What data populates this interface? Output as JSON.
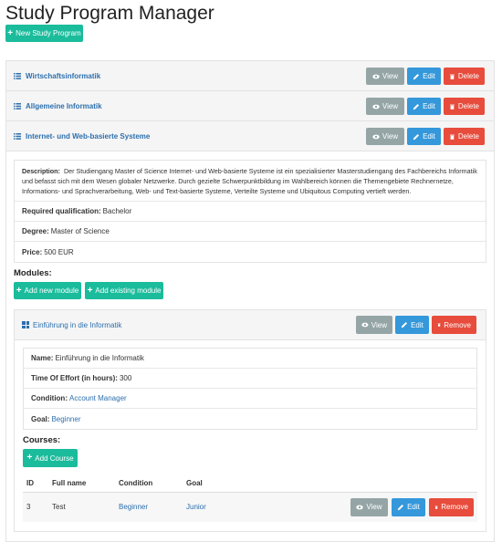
{
  "page": {
    "title": "Study Program Manager",
    "new_program_label": "New Study Program"
  },
  "actions": {
    "view": "View",
    "edit": "Edit",
    "delete": "Delete",
    "remove": "Remove"
  },
  "programs": [
    {
      "name": "Wirtschaftsinformatik"
    },
    {
      "name": "Allgemeine Informatik"
    },
    {
      "name": "Internet- und Web-basierte Systeme"
    }
  ],
  "expanded_program": {
    "description_label": "Description:",
    "description": "Der Studiengang Master of Science Internet- und Web-basierte Systeme ist ein spezialisierter Masterstudiengang des Fachbereichs Informatik und befasst sich mit dem Wesen globaler Netzwerke. Durch gezielte Schwerpunktbildung im Wahlbereich können die Themengebiete Rechnernetze, Informations- und Sprachverarbeitung, Web- und Text-basierte Systeme, Verteilte Systeme und Ubiquitous Computing vertieft werden.",
    "qualification_label": "Required qualification:",
    "qualification": "Bachelor",
    "degree_label": "Degree:",
    "degree": "Master of Science",
    "price_label": "Price:",
    "price": "500 EUR",
    "modules_heading": "Modules:",
    "add_new_module": "Add new module",
    "add_existing_module": "Add existing module"
  },
  "module": {
    "title": "Einführung in die Informatik",
    "name_label": "Name:",
    "name": "Einführung in die Informatik",
    "effort_label": "Time Of Effort (in hours):",
    "effort": "300",
    "condition_label": "Condition:",
    "condition": "Account Manager",
    "goal_label": "Goal:",
    "goal": "Beginner",
    "courses_heading": "Courses:",
    "add_course": "Add Course"
  },
  "courses": {
    "headers": [
      "ID",
      "Full name",
      "Condition",
      "Goal"
    ],
    "rows": [
      {
        "id": "3",
        "full_name": "Test",
        "condition": "Beginner",
        "goal": "Junior"
      }
    ]
  },
  "colors": {
    "teal": "#1abc9c",
    "gray": "#95a5a6",
    "blue": "#3498db",
    "red": "#e74c3c",
    "link": "#2c6fad"
  }
}
